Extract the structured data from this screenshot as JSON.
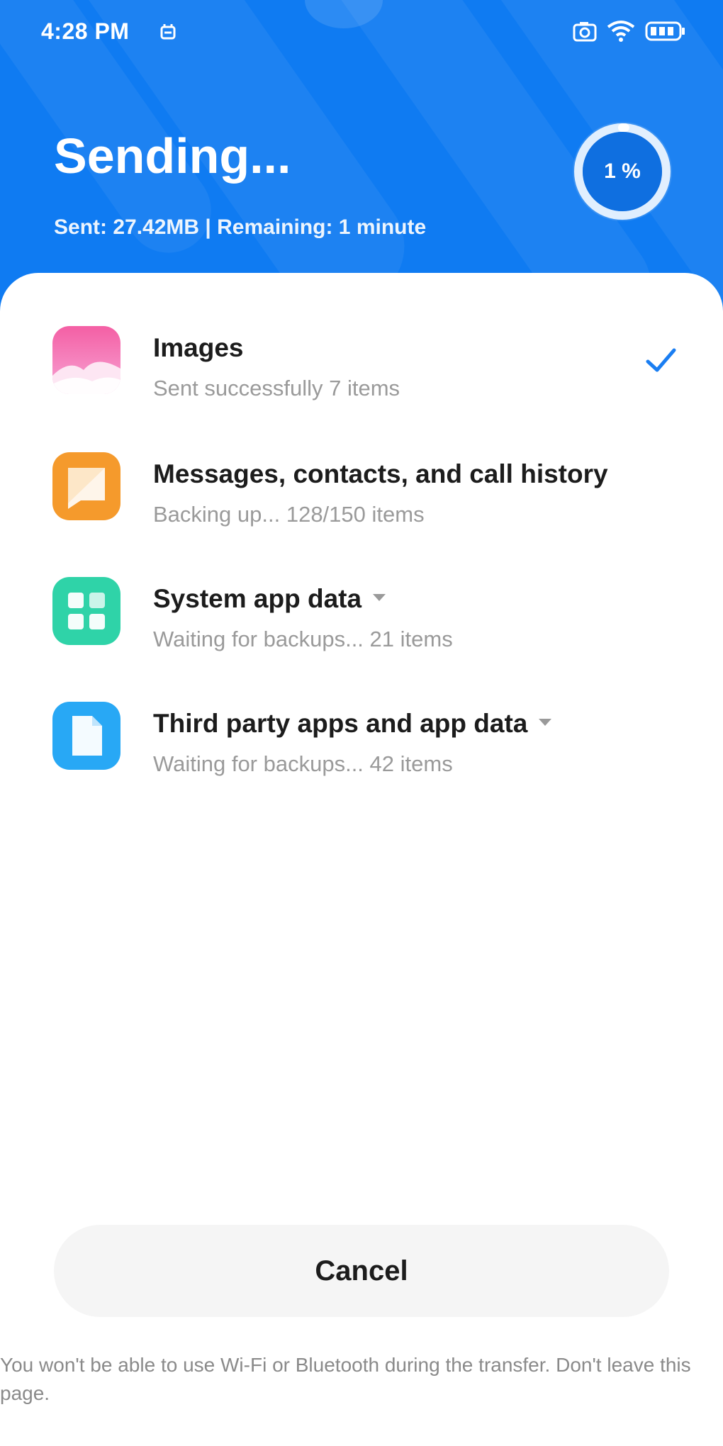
{
  "status_bar": {
    "time": "4:28 PM"
  },
  "header": {
    "title": "Sending...",
    "subtitle": "Sent: 27.42MB | Remaining: 1 minute",
    "progress_label": "1 %",
    "progress_fraction": 0.01
  },
  "items": [
    {
      "name": "Images",
      "status": "Sent successfully 7 items",
      "icon": "gallery-icon",
      "done": true
    },
    {
      "name": "Messages, contacts, and call history",
      "status": "Backing up... 128/150 items",
      "icon": "messages-icon",
      "done": false
    },
    {
      "name": "System app data",
      "status": "Waiting for backups... 21 items",
      "icon": "system-apps-icon",
      "done": false
    },
    {
      "name": "Third party apps and app data",
      "status": "Waiting for backups... 42 items",
      "icon": "document-icon",
      "done": false
    }
  ],
  "cancel_label": "Cancel",
  "footnote": "You won't be able to use Wi-Fi or Bluetooth during the transfer. Don't leave this page.",
  "colors": {
    "header_blue": "#0f7bf2",
    "check_blue": "#1a7ef2",
    "gallery_pink": "#f06bb0",
    "messages_orange": "#f59a2c",
    "system_green": "#2fd3a8",
    "document_blue": "#28a8f5"
  }
}
